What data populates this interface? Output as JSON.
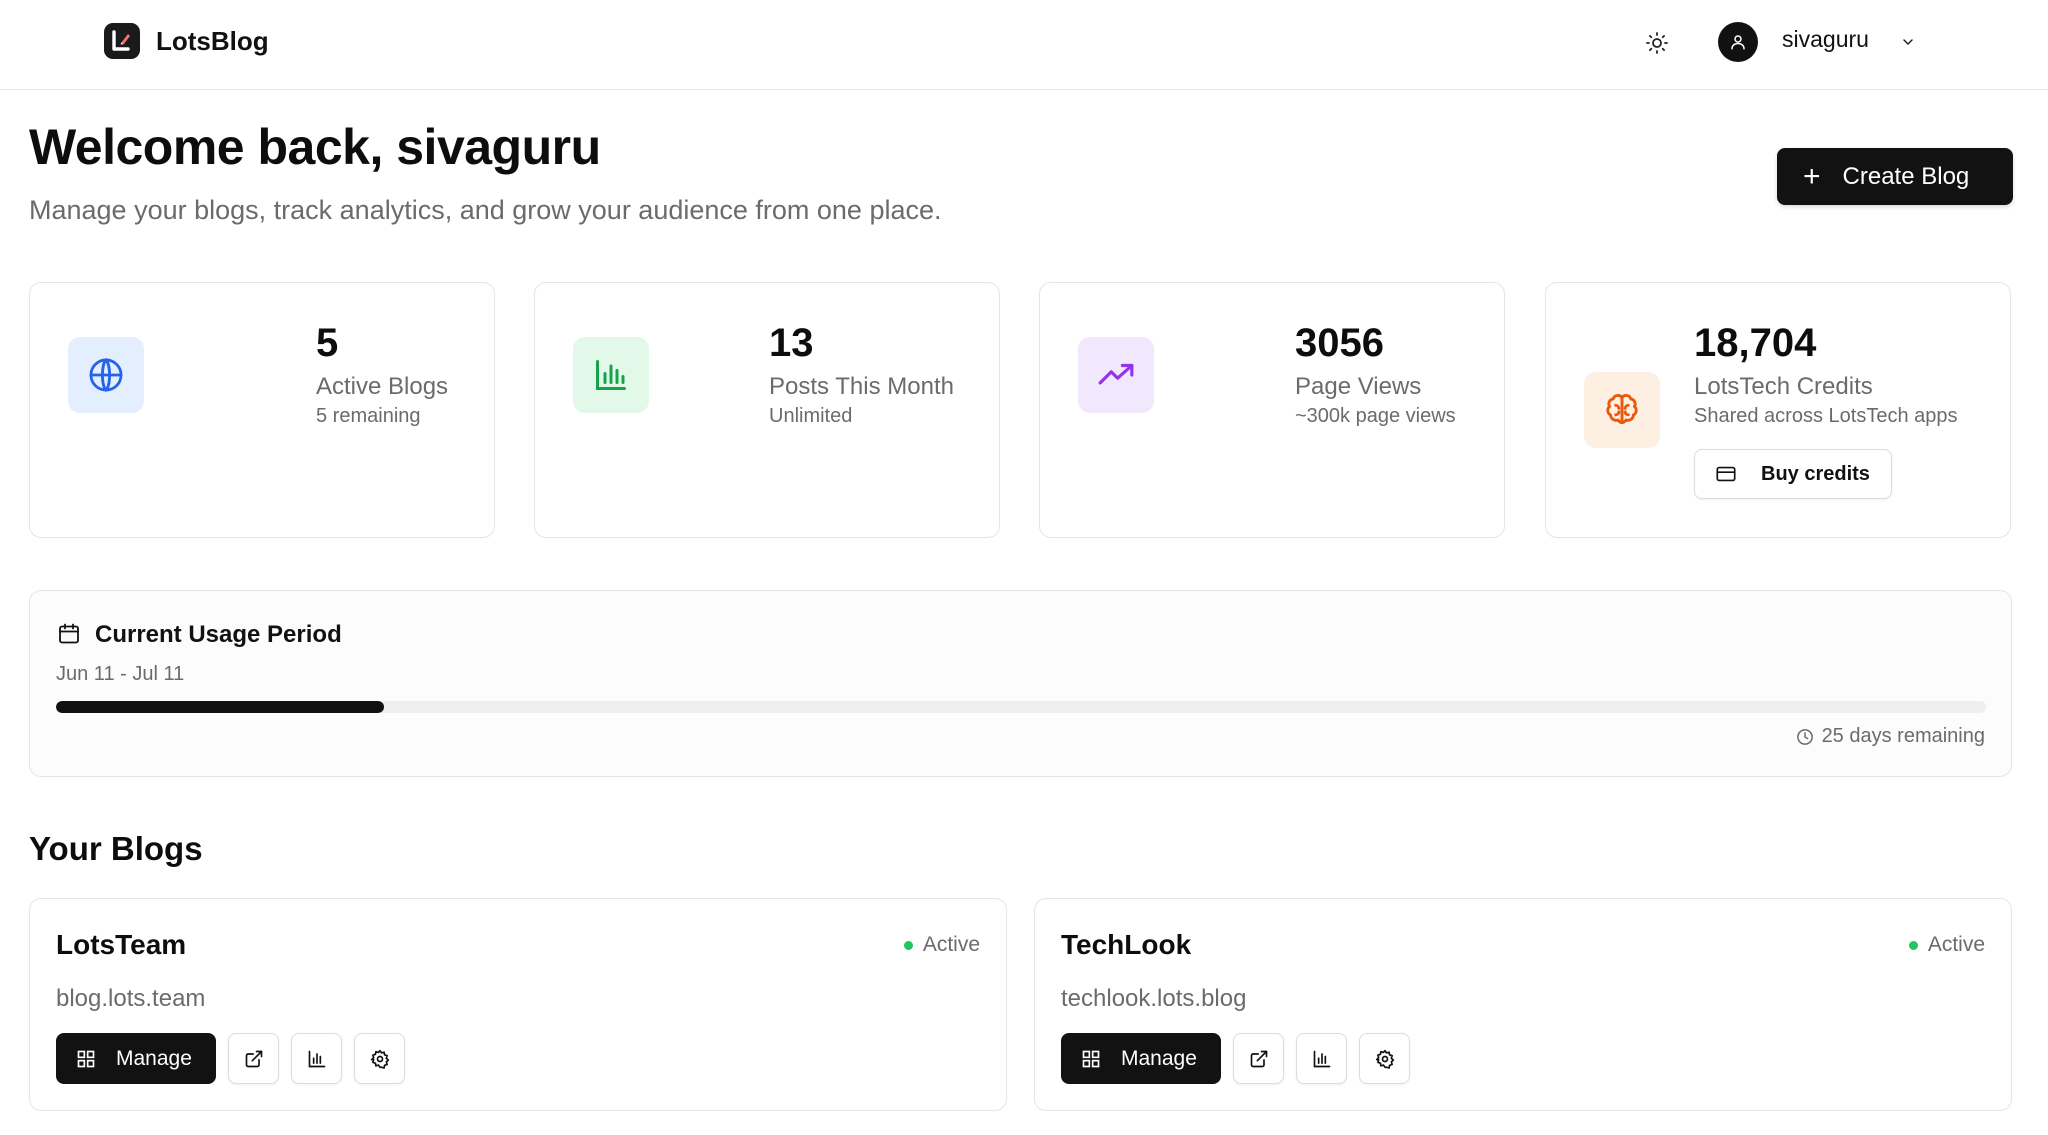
{
  "header": {
    "app_name": "LotsBlog",
    "user": {
      "name": "sivaguru"
    }
  },
  "welcome": {
    "title": "Welcome back, sivaguru",
    "subtitle": "Manage your blogs, track analytics, and grow your audience from one place.",
    "create_label": "Create Blog"
  },
  "stats": [
    {
      "value": "5",
      "label": "Active Blogs",
      "sub": "5 remaining",
      "icon": "globe-icon",
      "color": "#2563eb",
      "bg": "#e3efff"
    },
    {
      "value": "13",
      "label": "Posts This Month",
      "sub": "Unlimited",
      "icon": "bar-chart-icon",
      "color": "#16a34a",
      "bg": "#e2f9ea"
    },
    {
      "value": "3056",
      "label": "Page Views",
      "sub": "~300k page views",
      "icon": "trending-up-icon",
      "color": "#9333ea",
      "bg": "#f1e8fd"
    },
    {
      "value": "18,704",
      "label": "LotsTech Credits",
      "sub": "Shared across LotsTech apps",
      "icon": "brain-icon",
      "color": "#ea580c",
      "bg": "#fdf0e2",
      "action_label": "Buy credits"
    }
  ],
  "usage": {
    "title": "Current Usage Period",
    "dates": "Jun 11 - Jul 11",
    "progress_percent": 17,
    "remaining": "25 days remaining"
  },
  "blogs_section": {
    "title": "Your Blogs",
    "blogs": [
      {
        "name": "LotsTeam",
        "status": "Active",
        "url": "blog.lots.team",
        "manage_label": "Manage"
      },
      {
        "name": "TechLook",
        "status": "Active",
        "url": "techlook.lots.blog",
        "manage_label": "Manage"
      }
    ]
  },
  "colors": {
    "primary": "#121212",
    "status_active": "#22c55e",
    "muted_text": "#6b6b6b"
  }
}
